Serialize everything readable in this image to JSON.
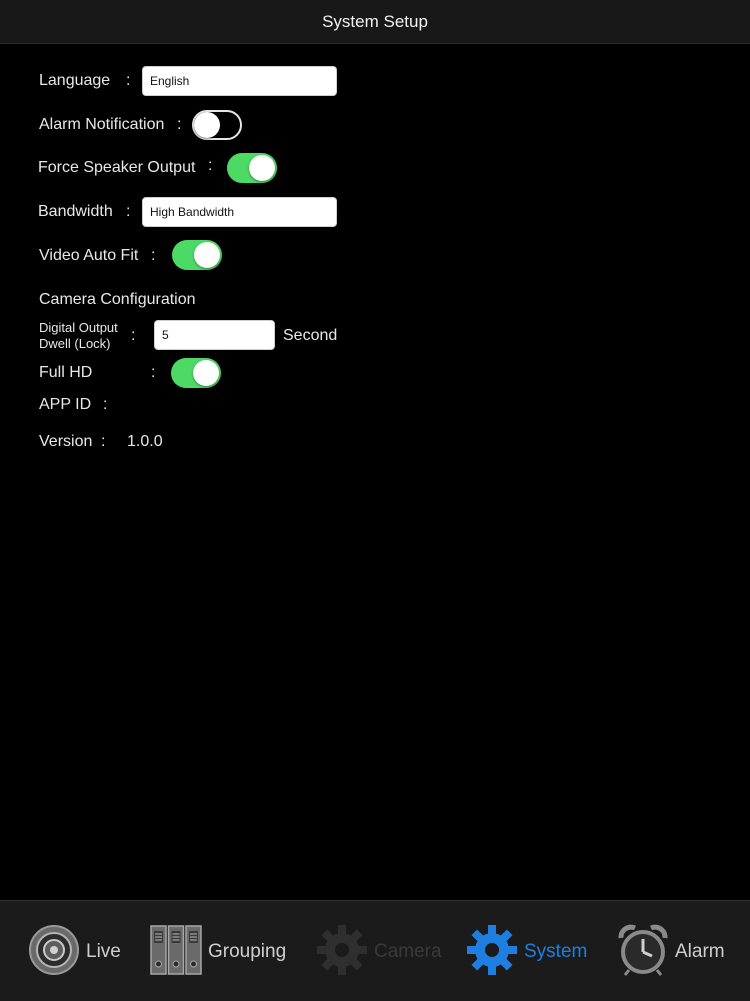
{
  "header": {
    "title": "System Setup"
  },
  "settings": {
    "language": {
      "label": "Language",
      "colon": ":",
      "value": "English"
    },
    "alarm_notification": {
      "label": "Alarm Notification",
      "colon": ":",
      "enabled": false
    },
    "force_speaker_output": {
      "label": "Force Speaker Output",
      "colon": ":",
      "enabled": true
    },
    "bandwidth": {
      "label": "Bandwidth",
      "colon": ":",
      "value": "High Bandwidth"
    },
    "video_auto_fit": {
      "label": "Video Auto Fit",
      "colon": ":",
      "enabled": true
    },
    "camera_configuration": {
      "label": "Camera Configuration"
    },
    "digital_output_dwell": {
      "label_line1": "Digital Output",
      "label_line2": "Dwell (Lock)",
      "colon": ":",
      "value": "5",
      "unit": "Second"
    },
    "full_hd": {
      "label": "Full HD",
      "colon": ":",
      "enabled": true
    },
    "app_id": {
      "label": "APP ID",
      "colon": ":"
    },
    "version": {
      "label": "Version",
      "colon": ":",
      "value": "1.0.0"
    }
  },
  "tabs": [
    {
      "label": "Live",
      "icon": "live-icon",
      "state": "normal"
    },
    {
      "label": "Grouping",
      "icon": "grouping-icon",
      "state": "normal"
    },
    {
      "label": "Camera",
      "icon": "camera-gear-icon",
      "state": "disabled"
    },
    {
      "label": "System",
      "icon": "system-gear-icon",
      "state": "selected"
    },
    {
      "label": "Alarm",
      "icon": "alarm-clock-icon",
      "state": "normal"
    }
  ],
  "colors": {
    "background": "#000000",
    "navbar": "#181818",
    "tabbar": "#1b1b1b",
    "toggle_on": "#4cd964",
    "tab_selected": "#1e7fe0",
    "tab_normal": "#cfcfcf",
    "tab_disabled": "#3a3a3a"
  }
}
